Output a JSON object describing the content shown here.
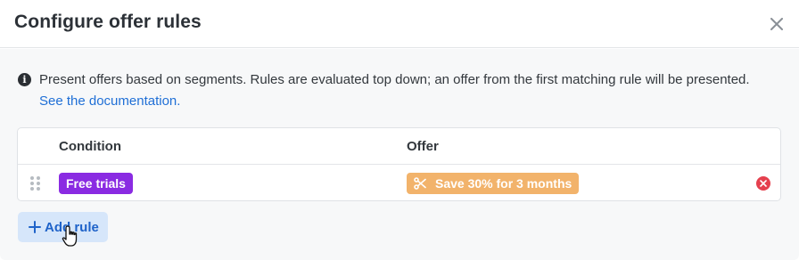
{
  "dialog": {
    "title": "Configure offer rules",
    "close_icon": "close-icon"
  },
  "info": {
    "icon": "info-icon",
    "icon_glyph": "i",
    "text": "Present offers based on segments. Rules are evaluated top down; an offer from the first matching rule will be presented.",
    "link_text": "See the documentation."
  },
  "table": {
    "columns": [
      "Condition",
      "Offer"
    ],
    "rows": [
      {
        "condition": "Free trials",
        "offer": "Save 30% for 3 months",
        "offer_icon": "scissors-icon",
        "remove_icon": "remove-icon"
      }
    ]
  },
  "actions": {
    "add_rule_label": "Add rule",
    "add_rule_icon": "plus-icon"
  },
  "colors": {
    "condition_tag": "#8a2be2",
    "offer_tag": "#f2b36b",
    "link": "#1f6fd6",
    "add_button_bg": "#d6e6fa",
    "remove": "#e5404e"
  }
}
